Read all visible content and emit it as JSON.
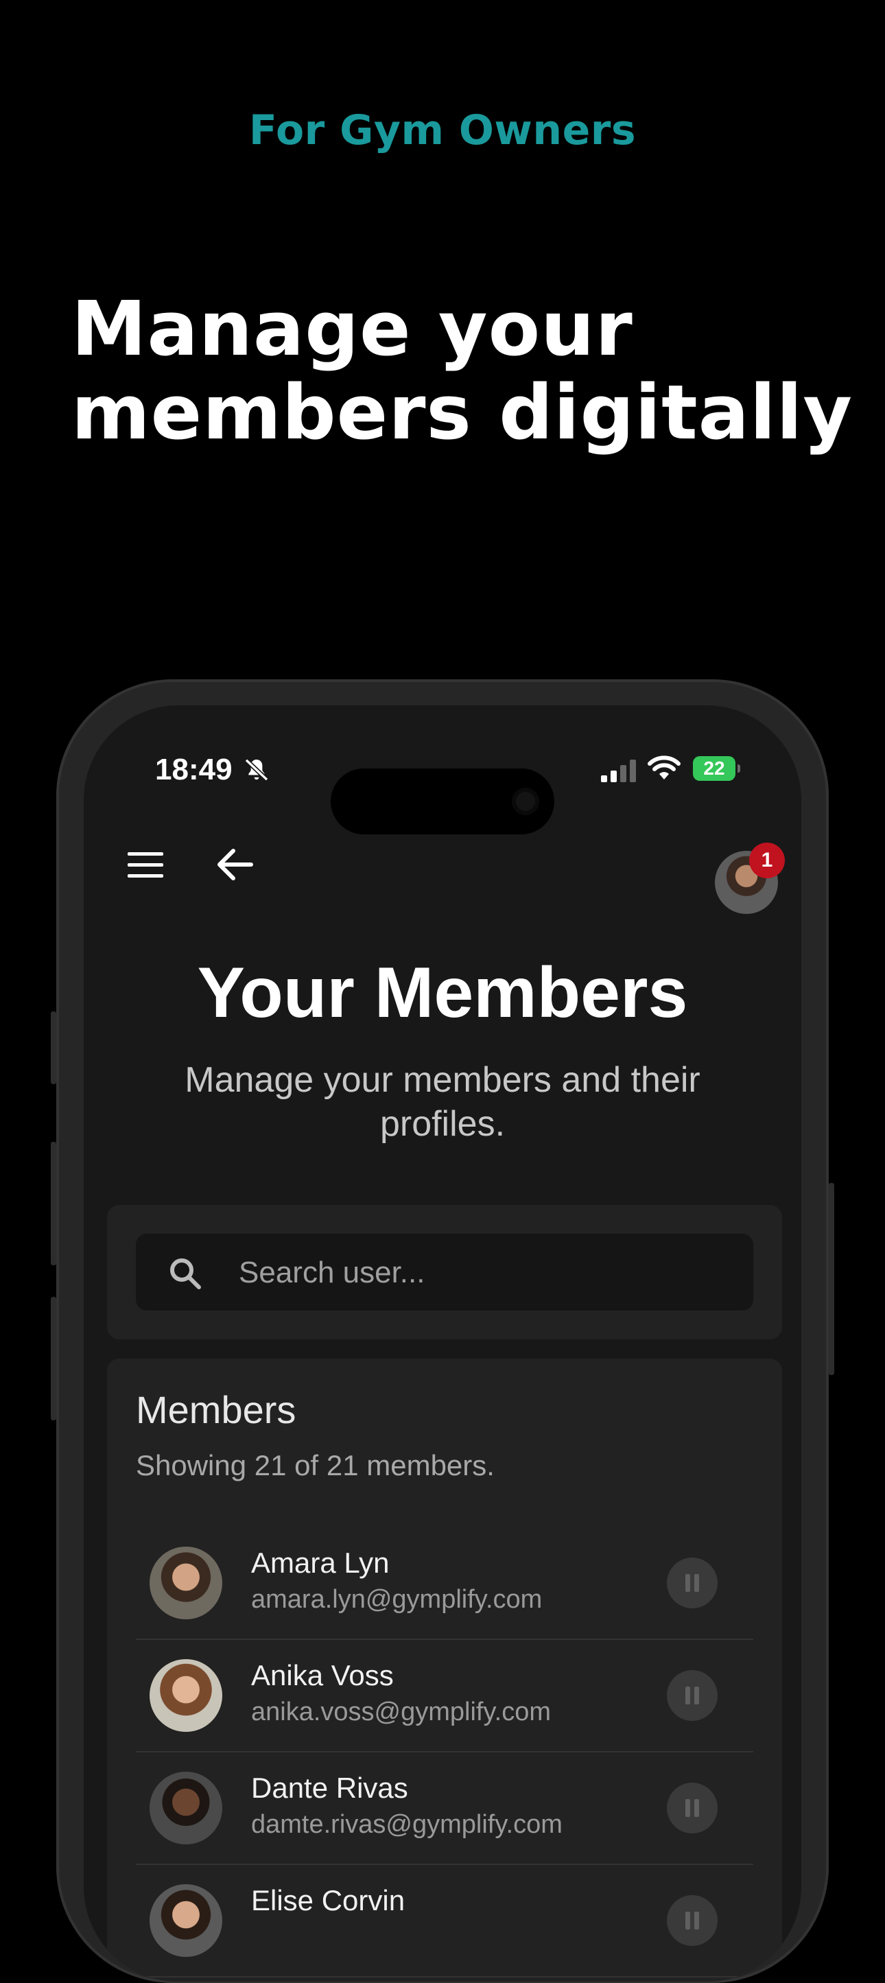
{
  "promo": {
    "eyebrow": "For Gym Owners",
    "headline_line1": "Manage your",
    "headline_line2": "members digitally"
  },
  "colors": {
    "accent_teal": "#1a9a9c",
    "badge_red": "#c1121f",
    "battery_green": "#34c759"
  },
  "status_bar": {
    "time": "18:49",
    "battery": "22",
    "icons": [
      "bell-slash-icon",
      "signal-icon",
      "wifi-icon",
      "battery-charging-icon"
    ]
  },
  "header": {
    "menu_icon": "hamburger-menu-icon",
    "back_icon": "arrow-left-icon",
    "notification_count": "1"
  },
  "page": {
    "title": "Your Members",
    "subtitle": "Manage your members and their profiles."
  },
  "search": {
    "placeholder": "Search user...",
    "value": ""
  },
  "members": {
    "heading": "Members",
    "count_text": "Showing 21 of 21 members.",
    "list": [
      {
        "name": "Amara Lyn",
        "email": "amara.lyn@gymplify.com"
      },
      {
        "name": "Anika Voss",
        "email": "anika.voss@gymplify.com"
      },
      {
        "name": "Dante Rivas",
        "email": "damte.rivas@gymplify.com"
      },
      {
        "name": "Elise Corvin",
        "email": ""
      }
    ]
  }
}
